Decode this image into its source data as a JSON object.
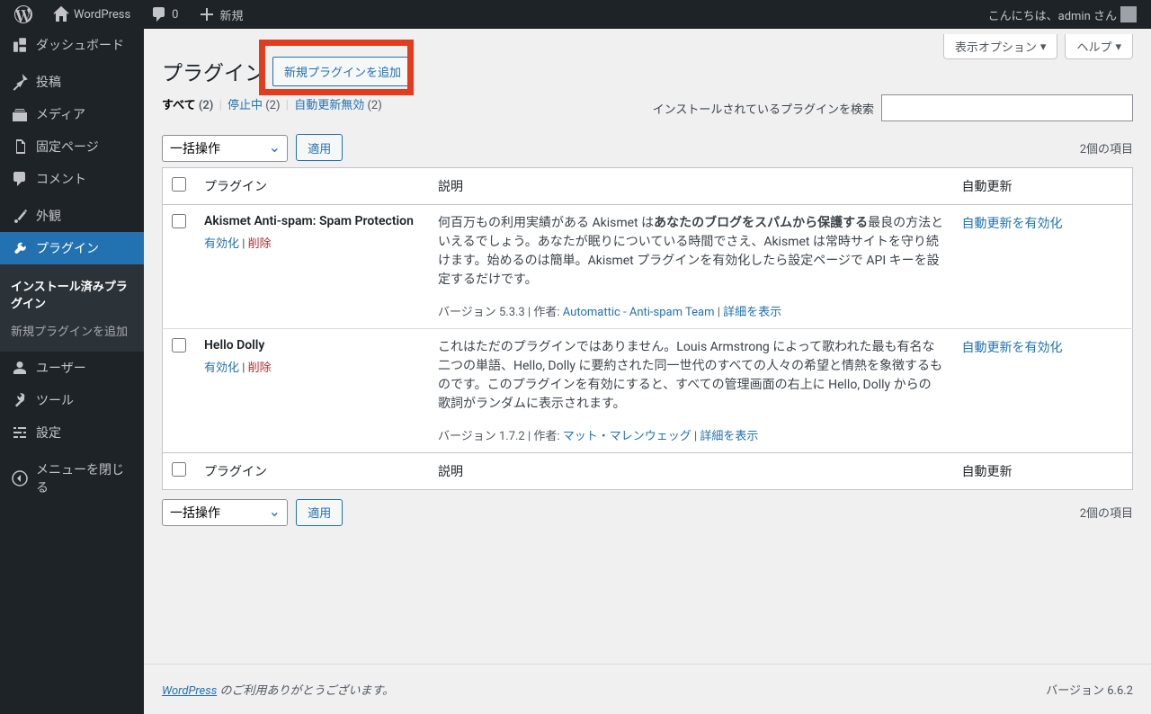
{
  "topbar": {
    "site_name": "WordPress",
    "comment_count": "0",
    "new_label": "新規",
    "greeting": "こんにちは、admin さん"
  },
  "sidebar": {
    "items": [
      {
        "label": "ダッシュボード"
      },
      {
        "label": "投稿"
      },
      {
        "label": "メディア"
      },
      {
        "label": "固定ページ"
      },
      {
        "label": "コメント"
      },
      {
        "label": "外観"
      },
      {
        "label": "プラグイン"
      },
      {
        "label": "ユーザー"
      },
      {
        "label": "ツール"
      },
      {
        "label": "設定"
      },
      {
        "label": "メニューを閉じる"
      }
    ],
    "sub_plugin": [
      {
        "label": "インストール済みプラグイン"
      },
      {
        "label": "新規プラグインを追加"
      }
    ]
  },
  "screen_options": {
    "label": "表示オプション",
    "help": "ヘルプ"
  },
  "page": {
    "title": "プラグイン",
    "add_new": "新規プラグインを追加"
  },
  "filters": {
    "all_label": "すべて",
    "all_count": "(2)",
    "inactive_label": "停止中",
    "inactive_count": "(2)",
    "auto_off_label": "自動更新無効",
    "auto_off_count": "(2)"
  },
  "search": {
    "label": "インストールされているプラグインを検索"
  },
  "bulk": {
    "placeholder": "一括操作",
    "apply": "適用"
  },
  "count_text": "2個の項目",
  "columns": {
    "plugin": "プラグイン",
    "desc": "説明",
    "auto": "自動更新"
  },
  "plugins": [
    {
      "name": "Akismet Anti-spam: Spam Protection",
      "activate": "有効化",
      "delete": "削除",
      "desc_pre": "何百万もの利用実績がある Akismet は",
      "desc_bold": "あなたのブログをスパムから保護する",
      "desc_post": "最良の方法といえるでしょう。あなたが眠りについている時間でさえ、Akismet は常時サイトを守り続けます。始めるのは簡単。Akismet プラグインを有効化したら設定ページで API キーを設定するだけです。",
      "version_label": "バージョン 5.3.3",
      "author_label": "作者:",
      "author": "Automattic - Anti-spam Team",
      "details": "詳細を表示",
      "auto_enable": "自動更新を有効化"
    },
    {
      "name": "Hello Dolly",
      "activate": "有効化",
      "delete": "削除",
      "desc_pre": "これはただのプラグインではありません。Louis Armstrong によって歌われた最も有名な二つの単語、Hello, Dolly に要約された同一世代のすべての人々の希望と情熱を象徴するものです。このプラグインを有効にすると、すべての管理画面の右上に Hello, Dolly からの歌詞がランダムに表示されます。",
      "desc_bold": "",
      "desc_post": "",
      "version_label": "バージョン 1.7.2",
      "author_label": "作者:",
      "author": "マット・マレンウェッグ",
      "details": "詳細を表示",
      "auto_enable": "自動更新を有効化"
    }
  ],
  "footer": {
    "wp_link": "WordPress",
    "thanks": " のご利用ありがとうございます。",
    "version": "バージョン 6.6.2"
  }
}
